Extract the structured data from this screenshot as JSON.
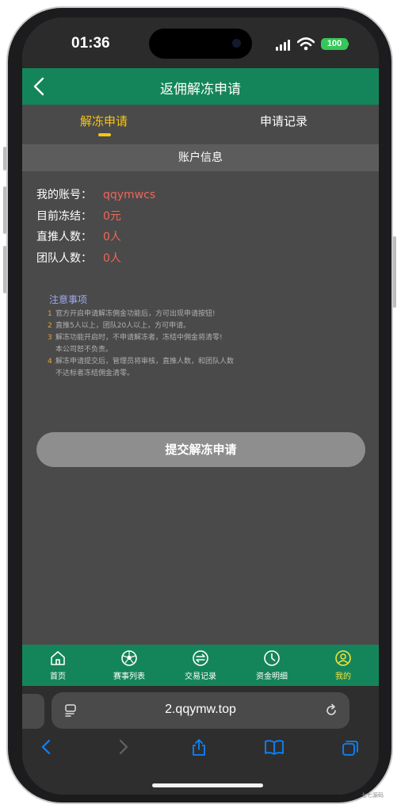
{
  "status_bar": {
    "time": "01:36",
    "battery": "100"
  },
  "nav": {
    "title": "返佣解冻申请"
  },
  "tabs": [
    {
      "label": "解冻申请"
    },
    {
      "label": "申请记录"
    }
  ],
  "section": {
    "title": "账户信息"
  },
  "account_info": [
    {
      "label": "我的账号：",
      "value": "qqymwcs"
    },
    {
      "label": "目前冻结：",
      "value": "0元"
    },
    {
      "label": "直推人数：",
      "value": "0人"
    },
    {
      "label": "团队人数：",
      "value": "0人"
    }
  ],
  "notice": {
    "title": "注意事项",
    "items": [
      {
        "num": "1",
        "text": "官方开启申请解冻佣金功能后，方可出现申请按钮!"
      },
      {
        "num": "2",
        "text": "直推5人以上，团队20人以上，方可申请。"
      },
      {
        "num": "3",
        "text": "解冻功能开启时，不申请解冻者，冻结中佣金将清零!",
        "cont": "本公司恕不负责。"
      },
      {
        "num": "4",
        "text": "解冻申请提交后，管理员将审核，直推人数，和团队人数",
        "cont": "不达标者冻结佣金清零。"
      }
    ]
  },
  "submit": {
    "label": "提交解冻申请"
  },
  "tabbar": [
    {
      "label": "首页",
      "icon": "home-icon"
    },
    {
      "label": "赛事列表",
      "icon": "soccer-ball-icon"
    },
    {
      "label": "交易记录",
      "icon": "exchange-icon"
    },
    {
      "label": "资金明细",
      "icon": "clock-icon"
    },
    {
      "label": "我的",
      "icon": "user-icon"
    }
  ],
  "browser": {
    "url": "2.qqymw.top"
  },
  "watermark": "七七源码",
  "colors": {
    "accent_green": "#14855a",
    "active_yellow": "#f5c518",
    "value_red": "#f0665a"
  }
}
